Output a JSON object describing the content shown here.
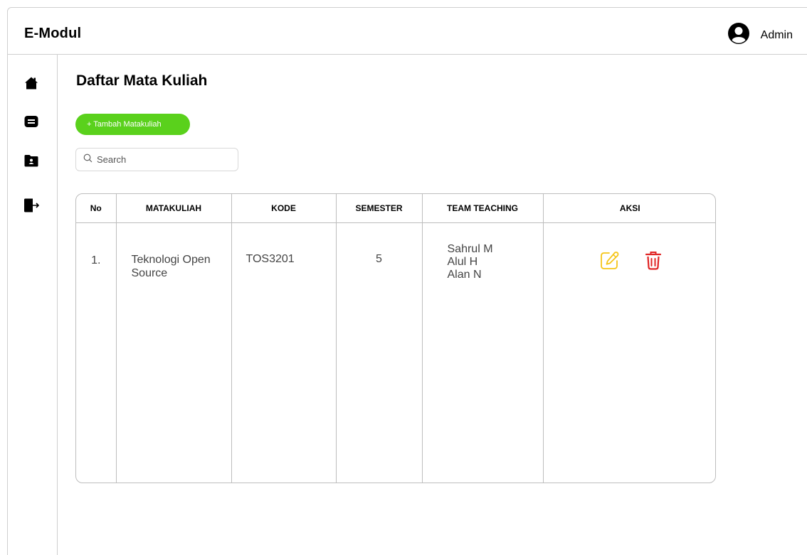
{
  "app": {
    "title": "E-Modul"
  },
  "user": {
    "name": "Admin",
    "icon": "user-circle-icon"
  },
  "sidebar": {
    "items": [
      {
        "icon": "home-icon"
      },
      {
        "icon": "message-icon"
      },
      {
        "icon": "folder-user-icon"
      },
      {
        "icon": "logout-icon"
      }
    ]
  },
  "main": {
    "title": "Daftar Mata Kuliah",
    "add_button_label": "+ Tambah Matakuliah",
    "search": {
      "placeholder": "Search",
      "value": ""
    }
  },
  "table": {
    "headers": {
      "no": "No",
      "matakuliah": "MATAKULIAH",
      "kode": "KODE",
      "semester": "SEMESTER",
      "team": "TEAM TEACHING",
      "aksi": "AKSI"
    },
    "rows": [
      {
        "no": "1.",
        "matakuliah": "Teknologi Open Source",
        "kode": "TOS3201",
        "semester": "5",
        "team": [
          "Sahrul M",
          "Alul H",
          "Alan N"
        ]
      }
    ]
  },
  "colors": {
    "accent_green": "#5ad11c",
    "edit_yellow": "#f5c518",
    "delete_red": "#e02424"
  }
}
